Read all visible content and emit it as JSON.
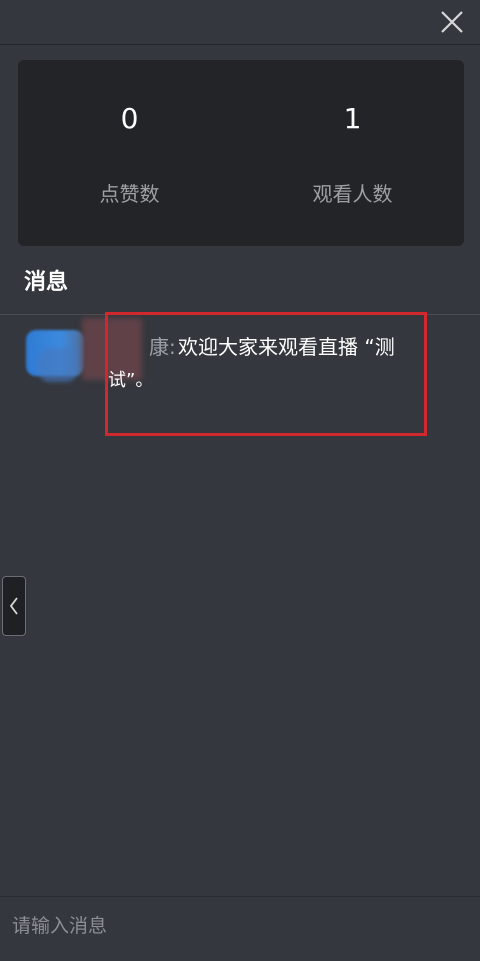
{
  "stats": {
    "likes_value": "0",
    "likes_label": "点赞数",
    "viewers_value": "1",
    "viewers_label": "观看人数"
  },
  "messages_section": {
    "title": "消息"
  },
  "chat": {
    "messages": [
      {
        "sender_tail": "康:",
        "text": "欢迎大家来观看直播 “测",
        "continuation": "试”。"
      }
    ]
  },
  "input": {
    "placeholder": "请输入消息"
  },
  "icons": {
    "close": "close-icon",
    "collapse": "chevron-left-icon"
  },
  "colors": {
    "background": "#34373d",
    "card": "#232428",
    "highlight": "#d0282d"
  }
}
